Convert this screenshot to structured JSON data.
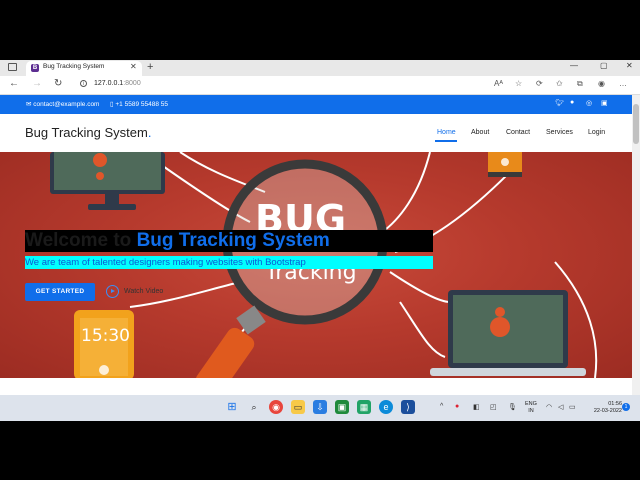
{
  "browser": {
    "tab_favicon": "B",
    "tab_title": "Bug Tracking System",
    "tab_close": "✕",
    "new_tab": "+",
    "minimize": "—",
    "maximize": "▢",
    "close": "✕",
    "back": "←",
    "forward": "→",
    "refresh": "↻",
    "info": "i",
    "url_host": "127.0.0.1",
    "url_port": ":8000",
    "icons": [
      "read-aloud-icon",
      "favorites-icon",
      "collections-icon",
      "favorites-bar-icon",
      "browser-essentials-icon",
      "profile-icon",
      "more-icon"
    ]
  },
  "topbar": {
    "email": "contact@example.com",
    "phone": "+1 5589 55488 55",
    "socials": [
      "twitter-icon",
      "facebook-icon",
      "instagram-icon",
      "linkedin-icon"
    ]
  },
  "header": {
    "logo_text": "Bug Tracking System",
    "logo_dot": ".",
    "nav": [
      "Home",
      "About",
      "Contact",
      "Services",
      "Login"
    ]
  },
  "hero": {
    "title_pre": "Welcome to ",
    "title_brand": "Bug Tracking System",
    "subtitle": "We are team of talented designers making websites with Bootstrap",
    "cta_label": "GET STARTED",
    "video_label": "Watch Video",
    "phone_time": "15:30",
    "art_text_1": "BUG",
    "art_text_2": "Tracking"
  },
  "taskbar": {
    "lang_1": "ENG",
    "lang_2": "IN",
    "time": "01:56",
    "date": "22-03-2022",
    "notifications": "1"
  },
  "colors": {
    "accent": "#106eea",
    "hero_bg": "#b63a2d",
    "subtitle_bg": "#00ffff"
  }
}
